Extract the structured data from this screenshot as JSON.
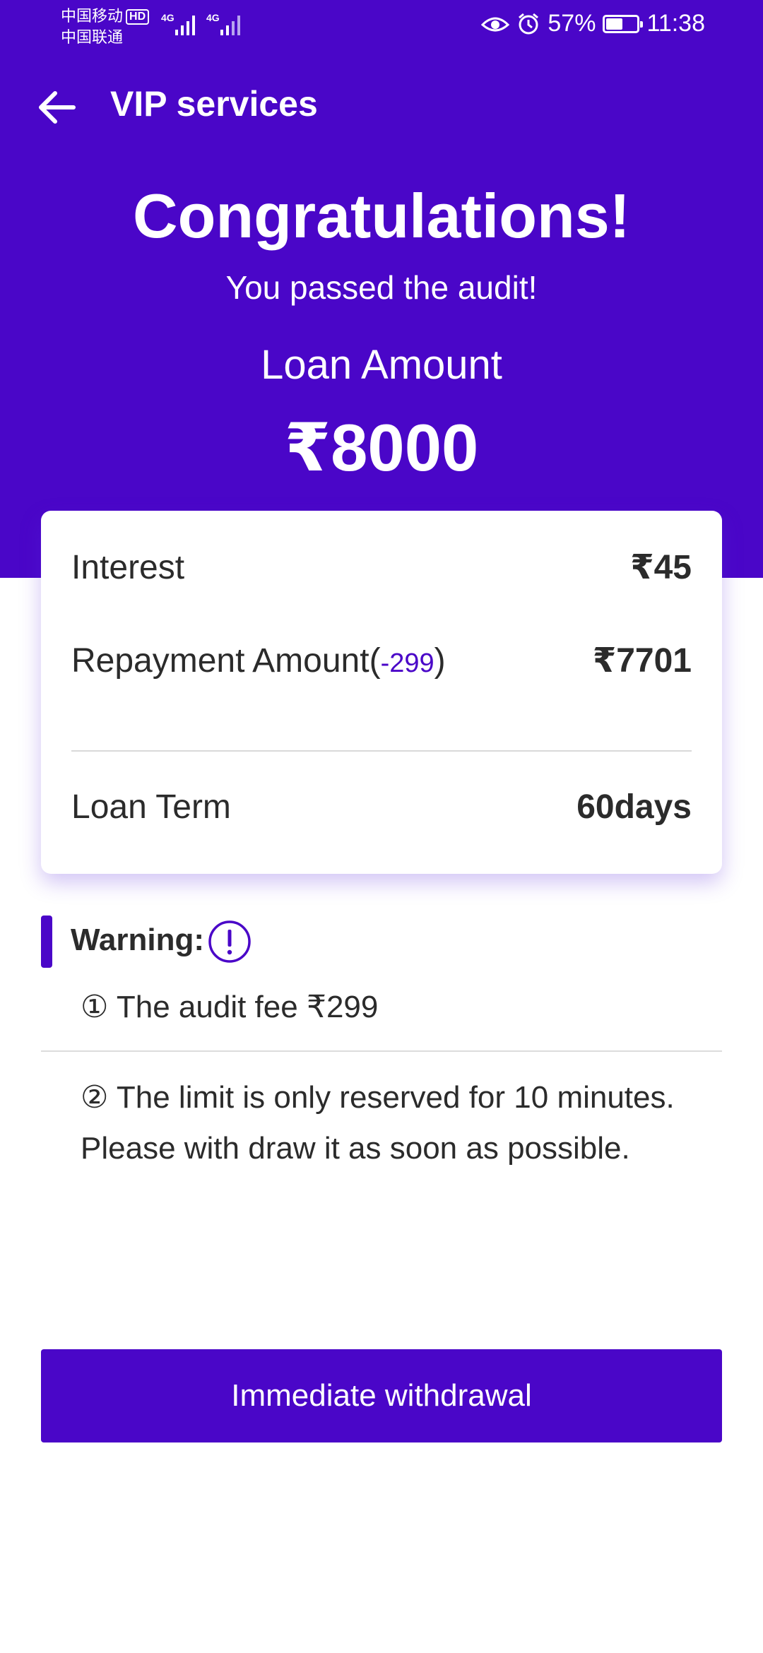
{
  "status_bar": {
    "carrier_1": "中国移动",
    "hd_badge": "HD",
    "carrier_2": "中国联通",
    "network_1": "4G",
    "network_2": "4G",
    "battery_percent": "57%",
    "battery_level": 0.57,
    "time": "11:38",
    "icons": [
      "eye-icon",
      "alarm-icon",
      "battery-icon",
      "signal-icon"
    ]
  },
  "header": {
    "title": "VIP services",
    "back_icon": "arrow-left-icon"
  },
  "hero": {
    "headline": "Congratulations!",
    "subline": "You passed the audit!",
    "loan_label": "Loan Amount",
    "loan_amount": "₹8000",
    "background_color": "#4a06c8"
  },
  "details": {
    "interest_label": "Interest",
    "interest_value": "₹45",
    "repayment_label_prefix": "Repayment Amount(",
    "repayment_deduction": "-299",
    "repayment_label_suffix": ")",
    "repayment_value": "₹7701",
    "term_label": "Loan Term",
    "term_value": "60days"
  },
  "warning": {
    "label": "Warning:",
    "icon": "exclamation-circle-icon",
    "note_1": "① The audit fee ₹299",
    "note_2_line_1": "② The limit is only reserved for 10 minutes.",
    "note_2_line_2": "Please with draw it as soon as possible."
  },
  "actions": {
    "withdraw_label": "Immediate withdrawal"
  }
}
